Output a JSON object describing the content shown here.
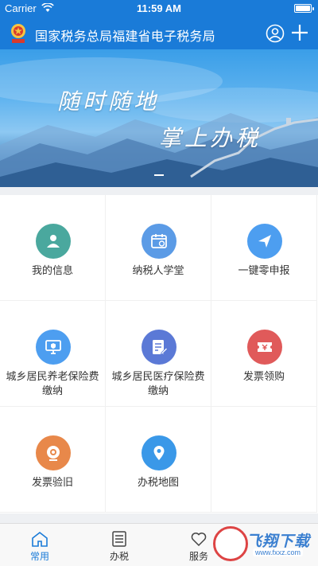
{
  "status_bar": {
    "carrier": "Carrier",
    "time": "11:59 AM"
  },
  "header": {
    "title": "国家税务总局福建省电子税务局",
    "user_icon": "user-circle-icon",
    "add_icon": "plus-icon"
  },
  "banner": {
    "slogan_line1": "随时随地",
    "slogan_line2": "掌上办税"
  },
  "grid": {
    "items": [
      {
        "label": "我的信息",
        "icon": "user-icon",
        "color": "#4aa89e"
      },
      {
        "label": "纳税人学堂",
        "icon": "calendar-play-icon",
        "color": "#5b9be6"
      },
      {
        "label": "一键零申报",
        "icon": "send-icon",
        "color": "#4d9ef0"
      },
      {
        "label": "城乡居民养老保险费缴纳",
        "icon": "monitor-shield-icon",
        "color": "#4d9ef0"
      },
      {
        "label": "城乡居民医疗保险费缴纳",
        "icon": "document-edit-icon",
        "color": "#5b79d6"
      },
      {
        "label": "发票领购",
        "icon": "ticket-icon",
        "color": "#e05a5a"
      },
      {
        "label": "发票验旧",
        "icon": "camera-icon",
        "color": "#e8884a"
      },
      {
        "label": "办税地图",
        "icon": "map-pin-icon",
        "color": "#3a98e8"
      }
    ]
  },
  "tabbar": {
    "tabs": [
      {
        "label": "常用",
        "icon": "home-icon",
        "active": true
      },
      {
        "label": "办税",
        "icon": "list-icon",
        "active": false
      },
      {
        "label": "服务",
        "icon": "heart-icon",
        "active": false
      }
    ]
  },
  "watermark": {
    "name": "飞翔下载",
    "url": "www.fxxz.com"
  },
  "colors": {
    "primary": "#1a7bd8",
    "active_tab": "#1a7bd8"
  }
}
